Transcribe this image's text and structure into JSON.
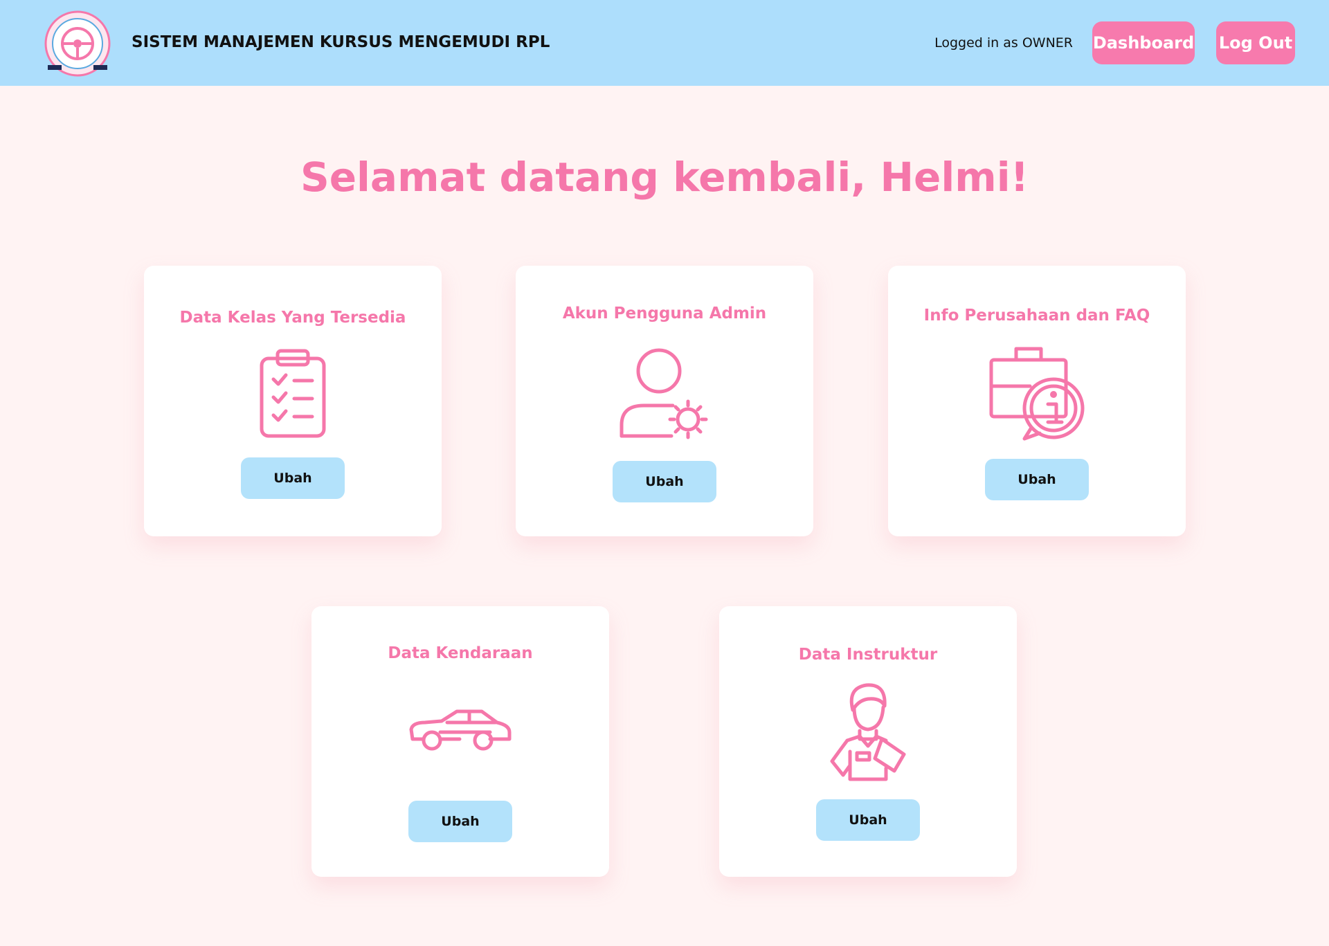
{
  "header": {
    "logo_icon": "steering-wheel-logo",
    "logo_text": "KURSUS MENGEMUDI RPL",
    "title": "SISTEM MANAJEMEN KURSUS MENGEMUDI RPL",
    "logged_in_text": "Logged in as OWNER",
    "dashboard_label": "Dashboard",
    "logout_label": "Log Out"
  },
  "welcome": "Selamat datang kembali, Helmi!",
  "cards": [
    {
      "title": "Data Kelas Yang Tersedia",
      "icon": "clipboard-checklist-icon",
      "button": "Ubah"
    },
    {
      "title": "Akun Pengguna Admin",
      "icon": "user-settings-icon",
      "button": "Ubah"
    },
    {
      "title": "Info Perusahaan dan FAQ",
      "icon": "briefcase-info-icon",
      "button": "Ubah"
    },
    {
      "title": "Data Kendaraan",
      "icon": "car-icon",
      "button": "Ubah"
    },
    {
      "title": "Data Instruktur",
      "icon": "instructor-icon",
      "button": "Ubah"
    }
  ],
  "colors": {
    "navbar": "#addefc",
    "accent_pink": "#f577aa",
    "button_blue": "#b3e2fb",
    "background": "#fff3f3"
  }
}
